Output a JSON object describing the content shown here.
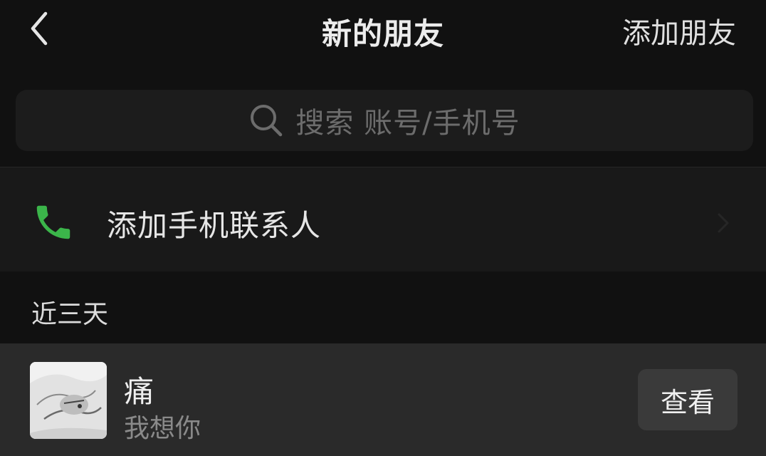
{
  "navbar": {
    "title": "新的朋友",
    "action_label": "添加朋友",
    "back_icon": "chevron-left-icon"
  },
  "search": {
    "placeholder": "搜索 账号/手机号",
    "icon": "search-icon"
  },
  "phone_contacts": {
    "label": "添加手机联系人",
    "icon": "phone-icon",
    "icon_color": "#3bb54a"
  },
  "section": {
    "header": "近三天"
  },
  "friends": [
    {
      "name": "痛",
      "message": "我想你",
      "button_label": "查看"
    }
  ],
  "colors": {
    "background": "#111111",
    "row_background": "#191919",
    "highlight_row": "#2a2a2a",
    "accent_green": "#3bb54a"
  }
}
